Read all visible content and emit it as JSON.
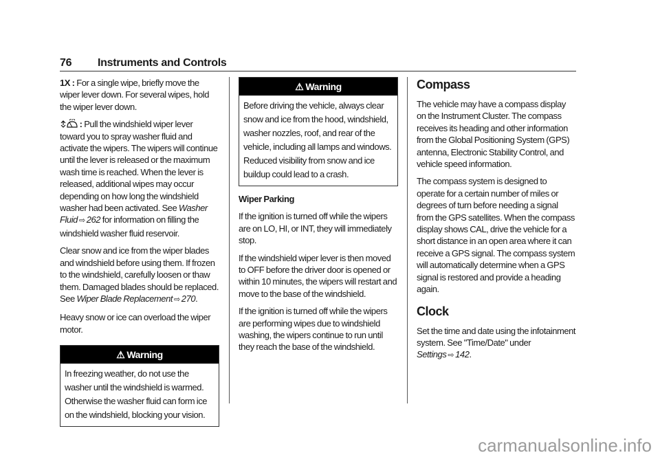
{
  "header": {
    "page_number": "76",
    "section_title": "Instruments and Controls"
  },
  "col1": {
    "p1_term": "1X :",
    "p1_text": " For a single wipe, briefly move the wiper lever down. For several wipes, hold the wiper lever down.",
    "p2_icon": "washer-wiper-icon",
    "p2_term": " :",
    "p2_text": " Pull the windshield wiper lever toward you to spray washer fluid and activate the wipers. The wipers will continue until the lever is released or the maximum wash time is reached. When the lever is released, additional wipes may occur depending on how long the windshield washer had been activated. See ",
    "p2_link": "Washer Fluid",
    "p2_page": "262",
    "p2_tail": " for information on filling the windshield washer fluid reservoir.",
    "p3_text": "Clear snow and ice from the wiper blades and windshield before using them. If frozen to the windshield, carefully loosen or thaw them. Damaged blades should be replaced. See ",
    "p3_link": "Wiper Blade Replacement",
    "p3_page": "270",
    "p3_tail": ".",
    "p4_text": "Heavy snow or ice can overload the wiper motor.",
    "warning": {
      "title": "Warning",
      "text": "In freezing weather, do not use the washer until the windshield is warmed. Otherwise the washer fluid can form ice on the windshield, blocking your vision."
    }
  },
  "col2": {
    "warning": {
      "title": "Warning",
      "text": "Before driving the vehicle, always clear snow and ice from the hood, windshield, washer nozzles, roof, and rear of the vehicle, including all lamps and windows. Reduced visibility from snow and ice buildup could lead to a crash."
    },
    "subheading": "Wiper Parking",
    "p1": "If the ignition is turned off while the wipers are on LO, HI, or INT, they will immediately stop.",
    "p2": "If the windshield wiper lever is then moved to OFF before the driver door is opened or within 10 minutes, the wipers will restart and move to the base of the windshield.",
    "p3": "If the ignition is turned off while the wipers are performing wipes due to windshield washing, the wipers continue to run until they reach the base of the windshield."
  },
  "col3": {
    "compass": {
      "heading": "Compass",
      "p1": "The vehicle may have a compass display on the Instrument Cluster. The compass receives its heading and other information from the Global Positioning System (GPS) antenna, Electronic Stability Control, and vehicle speed information.",
      "p2": "The compass system is designed to operate for a certain number of miles or degrees of turn before needing a signal from the GPS satellites. When the compass display shows CAL, drive the vehicle for a short distance in an open area where it can receive a GPS signal. The compass system will automatically determine when a GPS signal is restored and provide a heading again."
    },
    "clock": {
      "heading": "Clock",
      "p1_text": "Set the time and date using the infotainment system. See \"Time/Date\" under ",
      "p1_link": "Settings",
      "p1_page": "142",
      "p1_tail": "."
    }
  },
  "icons": {
    "xref": "⇨",
    "warning": "⚠"
  },
  "watermark": "carmanualsonline.info"
}
